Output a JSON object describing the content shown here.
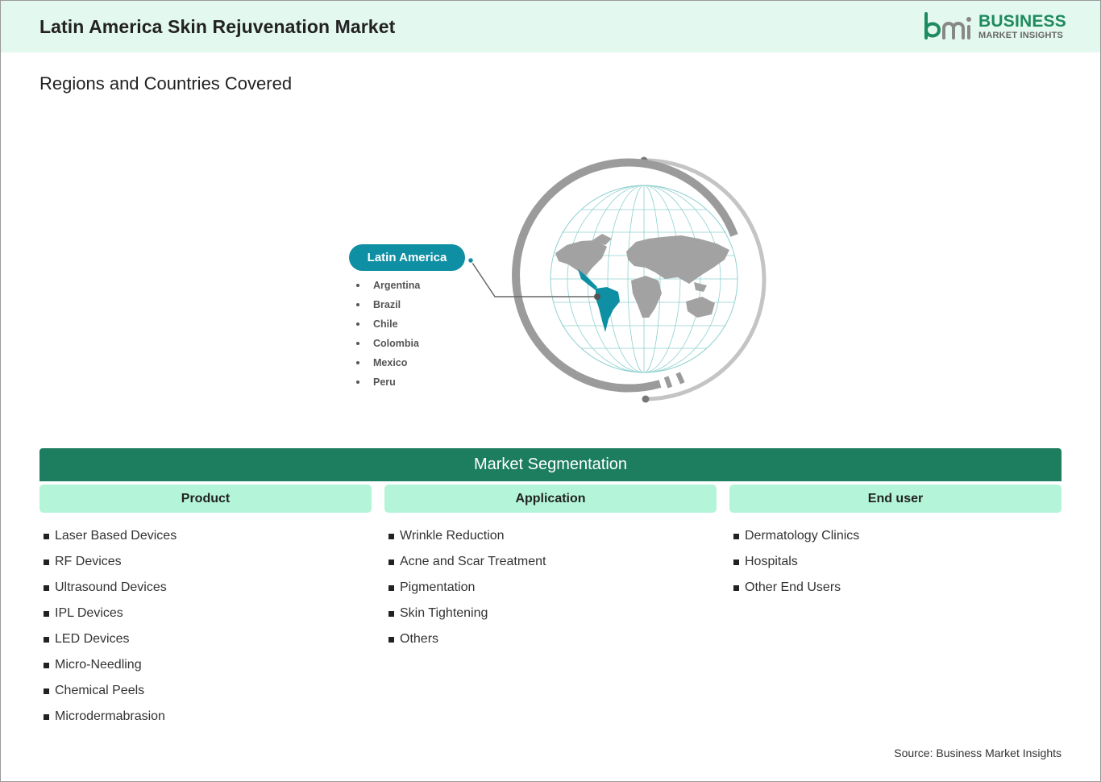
{
  "header": {
    "title": "Latin America Skin Rejuvenation Market",
    "logo": {
      "line1": "BUSINESS",
      "line2": "MARKET INSIGHTS",
      "brand_color": "#1e8a5f"
    }
  },
  "subtitle": "Regions and Countries Covered",
  "region": {
    "name": "Latin America",
    "accent_color": "#0f8fa3",
    "countries": [
      "Argentina",
      "Brazil",
      "Chile",
      "Colombia",
      "Mexico",
      "Peru"
    ]
  },
  "segmentation": {
    "title": "Market Segmentation",
    "bar_color": "#1c7d5f",
    "header_color": "#b4f5d9",
    "columns": [
      {
        "heading": "Product",
        "items": [
          "Laser Based Devices",
          "RF Devices",
          "Ultrasound Devices",
          "IPL Devices",
          "LED Devices",
          "Micro-Needling",
          "Chemical Peels",
          "Microdermabrasion"
        ]
      },
      {
        "heading": "Application",
        "items": [
          "Wrinkle Reduction",
          "Acne and Scar Treatment",
          "Pigmentation",
          "Skin Tightening",
          "Others"
        ]
      },
      {
        "heading": "End user",
        "items": [
          "Dermatology Clinics",
          "Hospitals",
          "Other End Users"
        ]
      }
    ]
  },
  "source": "Source: Business Market Insights"
}
